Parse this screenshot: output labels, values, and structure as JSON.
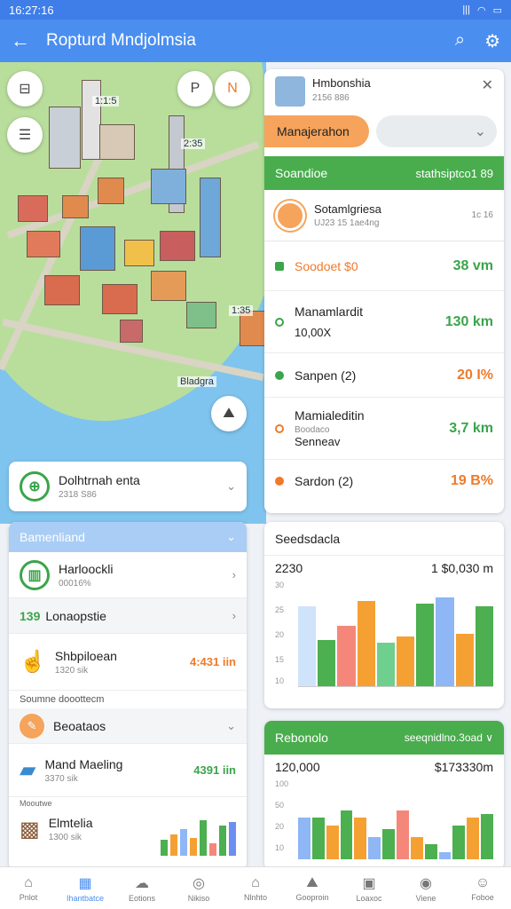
{
  "status": {
    "time": "16:27:16",
    "signal": "|||",
    "wifi": "wifi",
    "battery": "82"
  },
  "appbar": {
    "title": "Ropturd Mndjolmsia",
    "back_icon": "←",
    "search_icon": "⌕",
    "settings_icon": "⚙"
  },
  "map": {
    "labels": {
      "l1": "1:1:5",
      "l2": "2:35",
      "l3": "1:35",
      "l4": "Bladgra"
    },
    "btn_layers": "⊟",
    "btn_p": "P",
    "btn_n": "N",
    "btn_list": "☰",
    "btn_locate": "⛰"
  },
  "rpanel": {
    "title": "Hmbonshia",
    "subtitle": "2156 886",
    "tab_active": "Manajerahon",
    "section_title": "Soandioe",
    "section_right": "stathsiptco1 89",
    "sub_title": "Sotamlgriesa",
    "sub_line": "UJ23 15 1ae4ng",
    "sub_meta": "1c 16",
    "rows": [
      {
        "label": "Soodoet $0",
        "value": "38 vm",
        "dot": "#3aa54a",
        "valcolor": "green",
        "lblcolor": "orange"
      },
      {
        "label": "Manamlardit",
        "label2": "10,00X",
        "value": "130 km",
        "dot": "#3aa54a",
        "valcolor": "green"
      },
      {
        "label": "Sanpen (2)",
        "value": "20 I%",
        "dot": "#3aa54a",
        "valcolor": "orange"
      },
      {
        "label": "Mamialeditin",
        "label2": "Boodaco",
        "label3": "Senneav",
        "value": "3,7 km",
        "dot": "#ef7a2a",
        "valcolor": "green"
      },
      {
        "label": "Sardon (2)",
        "value": "19 B%",
        "dot": "#ef7a2a",
        "valcolor": "orange"
      }
    ]
  },
  "lcard1": {
    "title": "Dolhtrnah enta",
    "sub": "2318 S86"
  },
  "lpanel": {
    "header": "Bamenliand",
    "row1": {
      "title": "Harloockli",
      "sub": "00016%"
    },
    "row2": {
      "prefix": "139",
      "title": "Lonaopstie"
    },
    "row3": {
      "title": "Shbpiloean",
      "sub": "1320 sik",
      "value": "4:431 iin"
    },
    "section_label": "Soumne dooottecm",
    "row4": {
      "title": "Beoataos"
    },
    "row5": {
      "title": "Mand Maeling",
      "sub": "3370 sik",
      "value": "4391 iin"
    },
    "small_label": "Mooutwe",
    "row6": {
      "title": "Elmtelia",
      "sub": "1300 sik"
    }
  },
  "chart1": {
    "title": "Seedsdacla",
    "left": "2230",
    "right": "1 $0,030 m",
    "yticks": [
      "30",
      "25",
      "20",
      "15",
      "10"
    ]
  },
  "chart2": {
    "title": "Rebonolo",
    "right": "seeqnidlno.3oad ∨",
    "left": "120,000",
    "value": "$173330m",
    "yticks": [
      "100",
      "50",
      "20",
      "10"
    ]
  },
  "nav": [
    {
      "label": "Pnlot",
      "icon": "⌂"
    },
    {
      "label": "Ihantbatce",
      "icon": "▦"
    },
    {
      "label": "Eotions",
      "icon": "☁"
    },
    {
      "label": "Nikiso",
      "icon": "◎"
    },
    {
      "label": "Nlnhto",
      "icon": "⌂"
    },
    {
      "label": "Gooproin",
      "icon": "⛰"
    },
    {
      "label": "Loaxoc",
      "icon": "▣"
    },
    {
      "label": "Viene",
      "icon": "◉"
    },
    {
      "label": "Foboe",
      "icon": "☺"
    }
  ],
  "colors": {
    "primary": "#4a8ef0",
    "green": "#3aa54a",
    "orange": "#f6a35b"
  },
  "chart_data": [
    {
      "type": "bar",
      "title": "Seedsdacla",
      "series": [
        {
          "values": [
            29,
            17,
            22,
            31,
            16,
            18,
            30,
            32,
            19,
            29
          ]
        }
      ],
      "colors": [
        "#cfe3fb",
        "#4caf50",
        "#f5877a",
        "#f5a033",
        "#6fcf8f",
        "#f5a033",
        "#4caf50",
        "#8fb6f5",
        "#f5a033",
        "#4caf50",
        "#6b8ef0"
      ],
      "ylim": [
        0,
        35
      ]
    },
    {
      "type": "bar",
      "title": "Rebonolo",
      "series": [
        {
          "values": [
            55,
            55,
            45,
            65,
            55,
            30,
            40,
            65,
            30,
            20,
            10,
            45,
            55,
            60
          ]
        }
      ],
      "ylim": [
        0,
        100
      ]
    }
  ]
}
